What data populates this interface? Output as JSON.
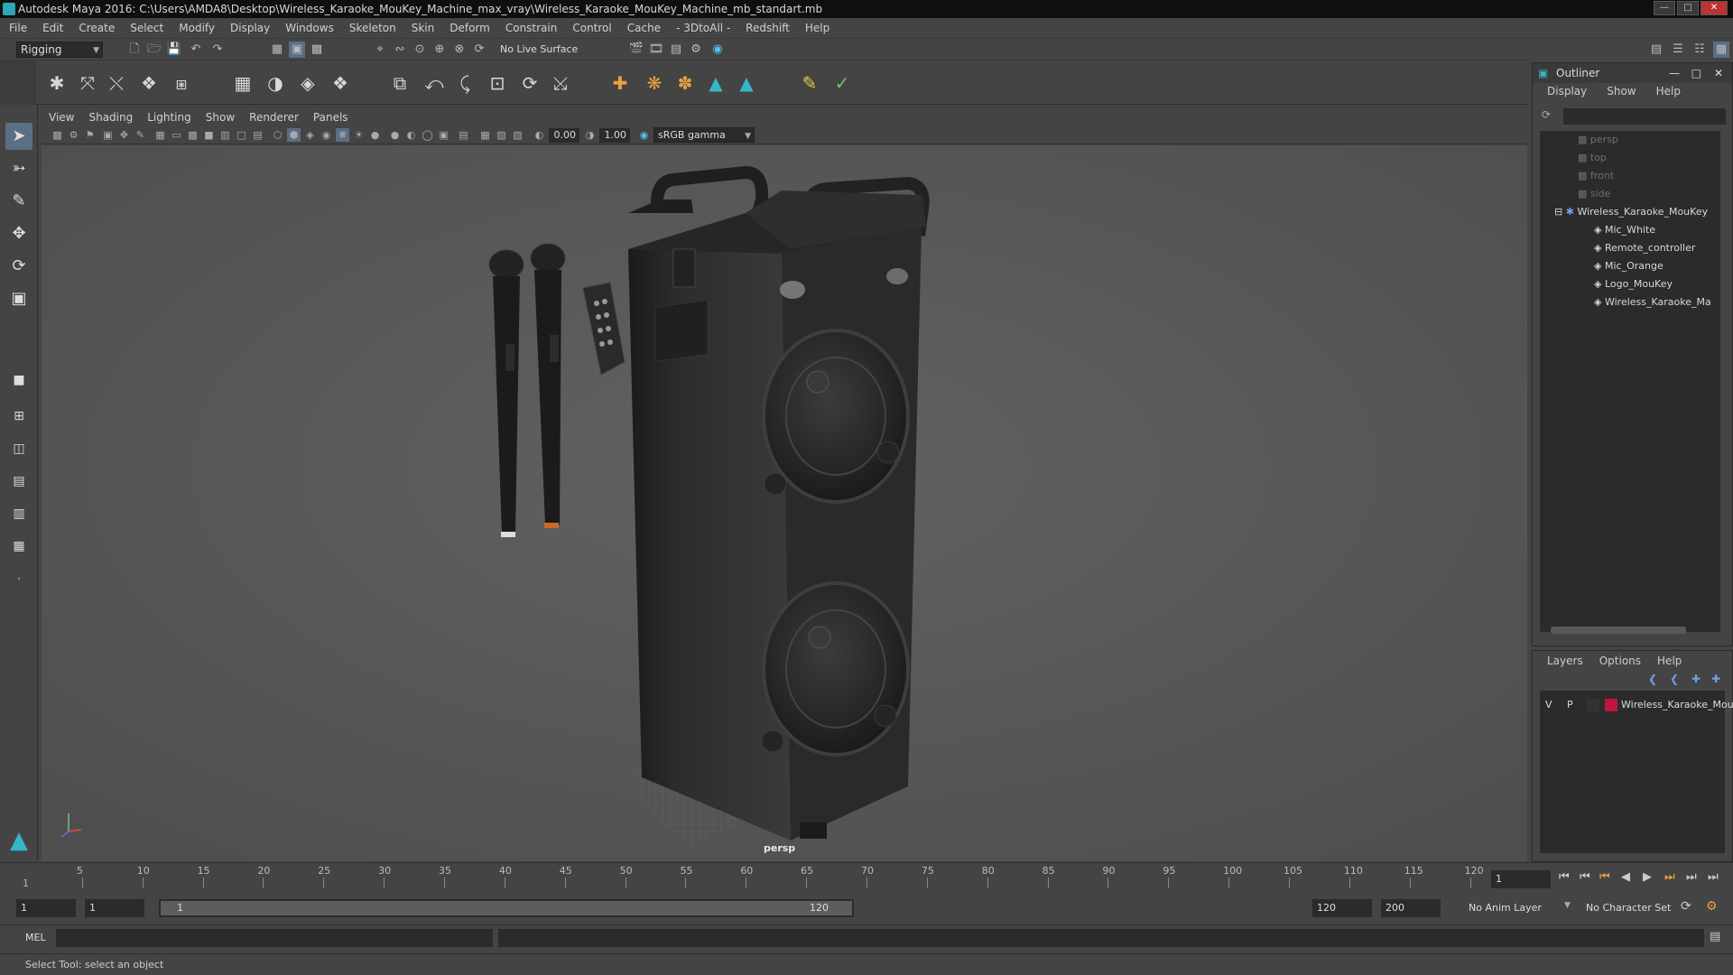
{
  "window": {
    "title": "Autodesk Maya 2016: C:\\Users\\AMDA8\\Desktop\\Wireless_Karaoke_MouKey_Machine_max_vray\\Wireless_Karaoke_MouKey_Machine_mb_standart.mb"
  },
  "menubar": [
    "File",
    "Edit",
    "Create",
    "Select",
    "Modify",
    "Display",
    "Windows",
    "Skeleton",
    "Skin",
    "Deform",
    "Constrain",
    "Control",
    "Cache",
    "- 3DtoAll -",
    "Redshift",
    "Help"
  ],
  "statusline": {
    "mode": "Rigging",
    "live_surface": "No Live Surface"
  },
  "panel": {
    "menu": [
      "View",
      "Shading",
      "Lighting",
      "Show",
      "Renderer",
      "Panels"
    ],
    "exposure": "0.00",
    "gamma": "1.00",
    "colorspace": "sRGB gamma",
    "camera_label": "persp"
  },
  "outliner": {
    "title": "Outliner",
    "menu": [
      "Display",
      "Show",
      "Help"
    ],
    "items": [
      {
        "label": "persp",
        "kind": "camera"
      },
      {
        "label": "top",
        "kind": "camera"
      },
      {
        "label": "front",
        "kind": "camera"
      },
      {
        "label": "side",
        "kind": "camera"
      },
      {
        "label": "Wireless_Karaoke_MouKey",
        "kind": "group"
      },
      {
        "label": "Mic_White",
        "kind": "mesh"
      },
      {
        "label": "Remote_controller",
        "kind": "mesh"
      },
      {
        "label": "Mic_Orange",
        "kind": "mesh"
      },
      {
        "label": "Logo_MouKey",
        "kind": "mesh"
      },
      {
        "label": "Wireless_Karaoke_Ma",
        "kind": "mesh"
      }
    ]
  },
  "layers": {
    "menu": [
      "Layers",
      "Options",
      "Help"
    ],
    "rows": [
      {
        "v": "V",
        "p": "P",
        "name": "Wireless_Karaoke_Mou",
        "color": "#c0143c"
      }
    ]
  },
  "timeline": {
    "ticks": [
      "5",
      "10",
      "15",
      "20",
      "25",
      "30",
      "35",
      "40",
      "45",
      "50",
      "55",
      "60",
      "65",
      "70",
      "75",
      "80",
      "85",
      "90",
      "95",
      "100",
      "105",
      "110",
      "115",
      "120"
    ],
    "start_label": "1",
    "current_frame": "1"
  },
  "range": {
    "start": "1",
    "playback_start": "1",
    "slider_left": "1",
    "slider_right": "120",
    "playback_end": "120",
    "end": "200",
    "anim_layer": "No Anim Layer",
    "character_set": "No Character Set"
  },
  "cmd": {
    "lang": "MEL"
  },
  "help": {
    "text": "Select Tool: select an object"
  }
}
